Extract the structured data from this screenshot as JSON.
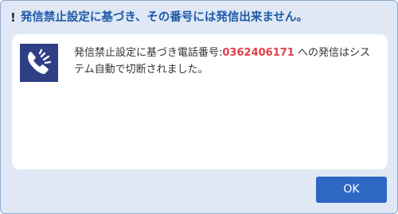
{
  "dialog": {
    "title": "発信禁止設定に基づき、その番号には発信出来ません。",
    "icon": "warning-exclamation-icon",
    "message_prefix": "発信禁止設定に基づき電話番号:",
    "phone_number": "0362406171",
    "message_suffix": " への発信はシステム自動で切断されました。",
    "phone_icon": "phone-cancelled-icon",
    "ok_label": "OK"
  },
  "colors": {
    "title": "#1e5aa8",
    "dialog_bg": "#dfe8f4",
    "panel_bg": "#ffffff",
    "phone_number": "#e0404a",
    "icon_bg": "#2f3f86",
    "button_bg": "#2f67c4"
  }
}
